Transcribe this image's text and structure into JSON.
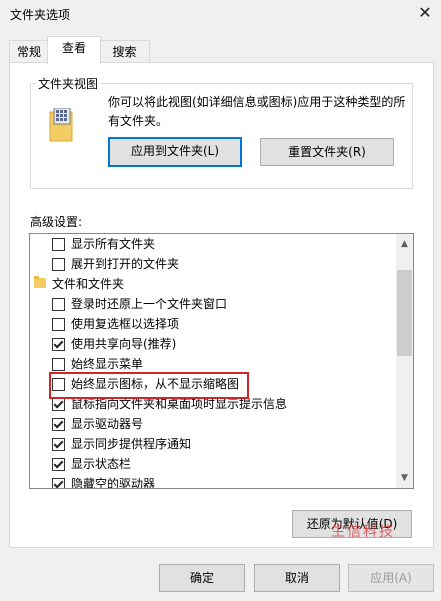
{
  "window": {
    "title": "文件夹选项",
    "close_glyph": "✕"
  },
  "tabs": [
    {
      "label": "常规"
    },
    {
      "label": "查看"
    },
    {
      "label": "搜索"
    }
  ],
  "folder_views": {
    "group_label": "文件夹视图",
    "description": "你可以将此视图(如详细信息或图标)应用于这种类型的所有文件夹。",
    "apply_button": "应用到文件夹(L)",
    "reset_button": "重置文件夹(R)"
  },
  "advanced": {
    "label": "高级设置:",
    "items": [
      {
        "type": "checkbox",
        "label": "显示所有文件夹",
        "checked": false
      },
      {
        "type": "checkbox",
        "label": "展开到打开的文件夹",
        "checked": false
      },
      {
        "type": "folder",
        "label": "文件和文件夹"
      },
      {
        "type": "checkbox",
        "label": "登录时还原上一个文件夹窗口",
        "checked": false
      },
      {
        "type": "checkbox",
        "label": "使用复选框以选择项",
        "checked": false
      },
      {
        "type": "checkbox",
        "label": "使用共享向导(推荐)",
        "checked": true
      },
      {
        "type": "checkbox",
        "label": "始终显示菜单",
        "checked": false
      },
      {
        "type": "checkbox",
        "label": "始终显示图标，从不显示缩略图",
        "checked": false
      },
      {
        "type": "checkbox",
        "label": "鼠标指向文件夹和桌面项时显示提示信息",
        "checked": true
      },
      {
        "type": "checkbox",
        "label": "显示驱动器号",
        "checked": true
      },
      {
        "type": "checkbox",
        "label": "显示同步提供程序通知",
        "checked": true
      },
      {
        "type": "checkbox",
        "label": "显示状态栏",
        "checked": true
      },
      {
        "type": "checkbox",
        "label": "隐藏空的驱动器",
        "checked": true
      }
    ],
    "restore_defaults": "还原为默认值(D)"
  },
  "footer": {
    "ok": "确定",
    "cancel": "取消",
    "apply": "应用(A)"
  },
  "watermark": "生信科技",
  "colors": {
    "accent": "#0078d7",
    "highlight": "#d0262b",
    "folder": "#f3cc63"
  }
}
